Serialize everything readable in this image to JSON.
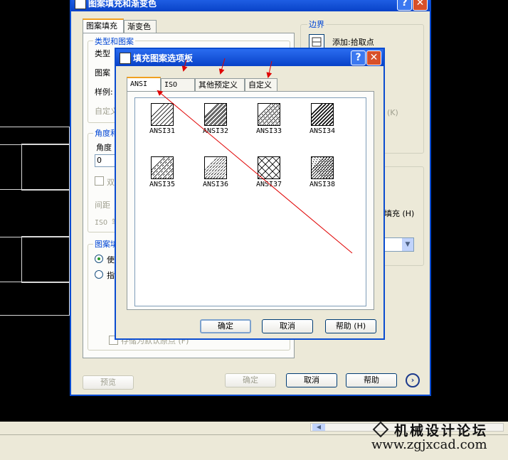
{
  "main_dialog": {
    "title": "图案填充和渐变色",
    "tabs": [
      "图案填充",
      "渐变色"
    ],
    "group_type_pattern": "类型和图案",
    "type_label": "类型",
    "pattern_label": "图案",
    "sample_label": "样例:",
    "custom_label": "自定义",
    "group_angle": "角度和比例",
    "angle_label": "角度",
    "angle_value": "0",
    "double_label": "双",
    "spacing_label": "间距",
    "iso_label": "ISO 笔",
    "group_origin": "图案填充原点",
    "origin_use": "使",
    "origin_specify": "指",
    "store_default": "存储为默认原点 (F)",
    "boundary_title": "边界",
    "add_pick_points": "添加:拾取点",
    "right_k": "(K)",
    "fill_h": "填充 (H)",
    "preview": "预览",
    "ok": "确定",
    "cancel": "取消",
    "help": "帮助"
  },
  "palette": {
    "title": "填充图案选项板",
    "tabs": [
      "ANSI",
      "ISO",
      "其他预定义",
      "自定义"
    ],
    "patterns": [
      "ANSI31",
      "ANSI32",
      "ANSI33",
      "ANSI34",
      "ANSI35",
      "ANSI36",
      "ANSI37",
      "ANSI38"
    ],
    "ok": "确定",
    "cancel": "取消",
    "help": "帮助 (H)"
  },
  "watermark": {
    "name": "机械设计论坛",
    "url": "www.zgjxcad.com"
  },
  "colors": {
    "title_blue": "#0a4cd0",
    "annotation_red": "#e00000",
    "dialog_bg": "#ece9d8"
  }
}
